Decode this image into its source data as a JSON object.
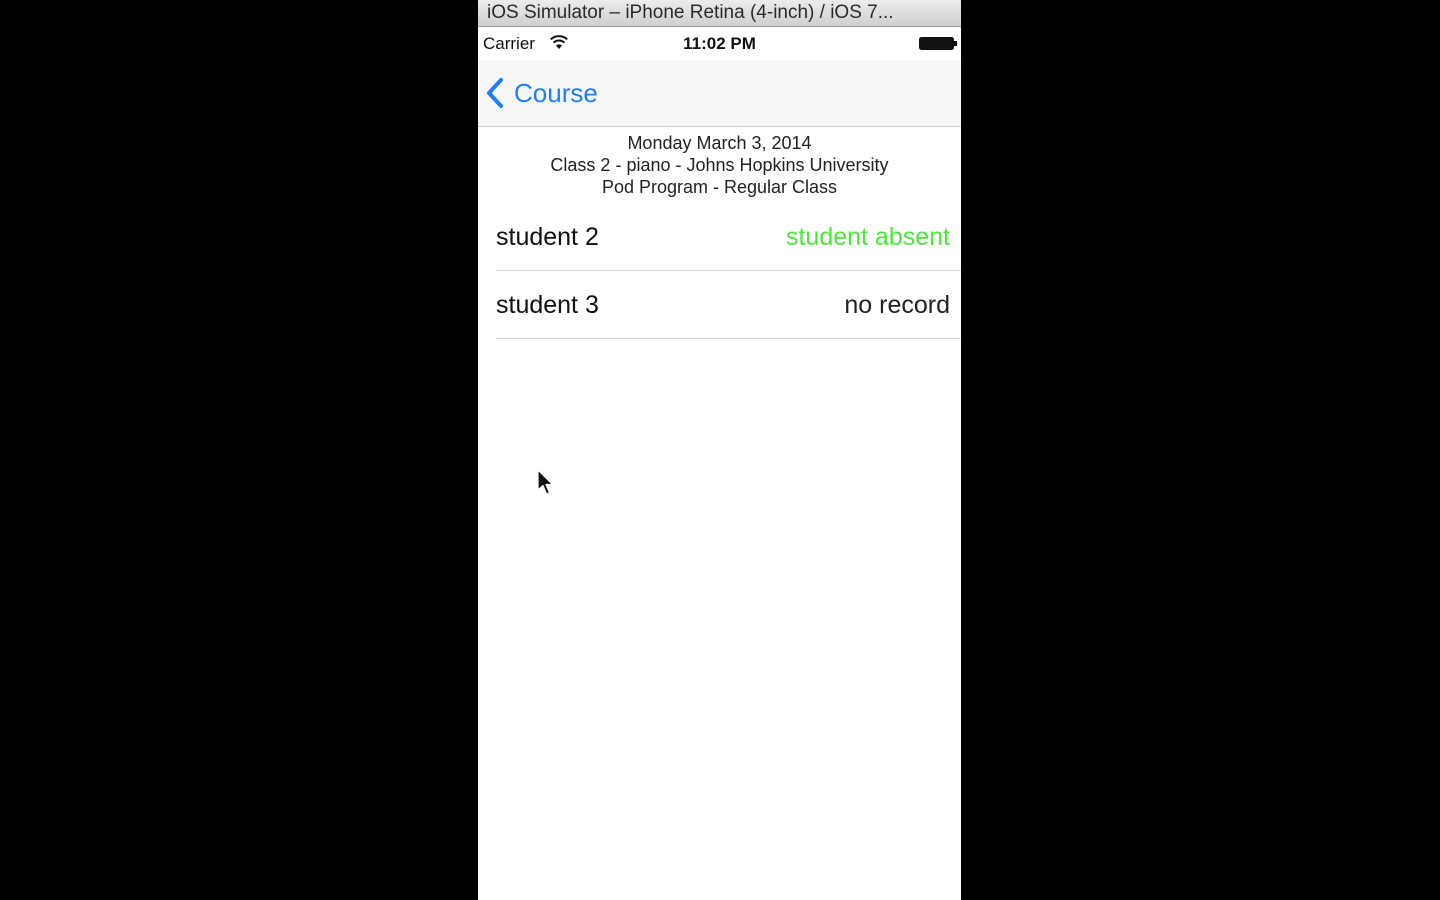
{
  "window": {
    "title": "iOS Simulator – iPhone Retina (4-inch) / iOS 7..."
  },
  "status_bar": {
    "carrier": "Carrier",
    "time": "11:02 PM",
    "icons": [
      "wifi-icon",
      "battery-icon"
    ]
  },
  "nav_bar": {
    "back_label": "Course",
    "back_icon": "chevron-left-icon",
    "tint_color": "#1f7ef2"
  },
  "header": {
    "date": "Monday March 3, 2014",
    "class_info": "Class 2 - piano - Johns Hopkins University",
    "program": "Pod Program - Regular Class"
  },
  "students": [
    {
      "name": "student 2",
      "status": "student absent",
      "status_color": "#4ae83a"
    },
    {
      "name": "student 3",
      "status": "no record",
      "status_color": "#222222"
    }
  ]
}
